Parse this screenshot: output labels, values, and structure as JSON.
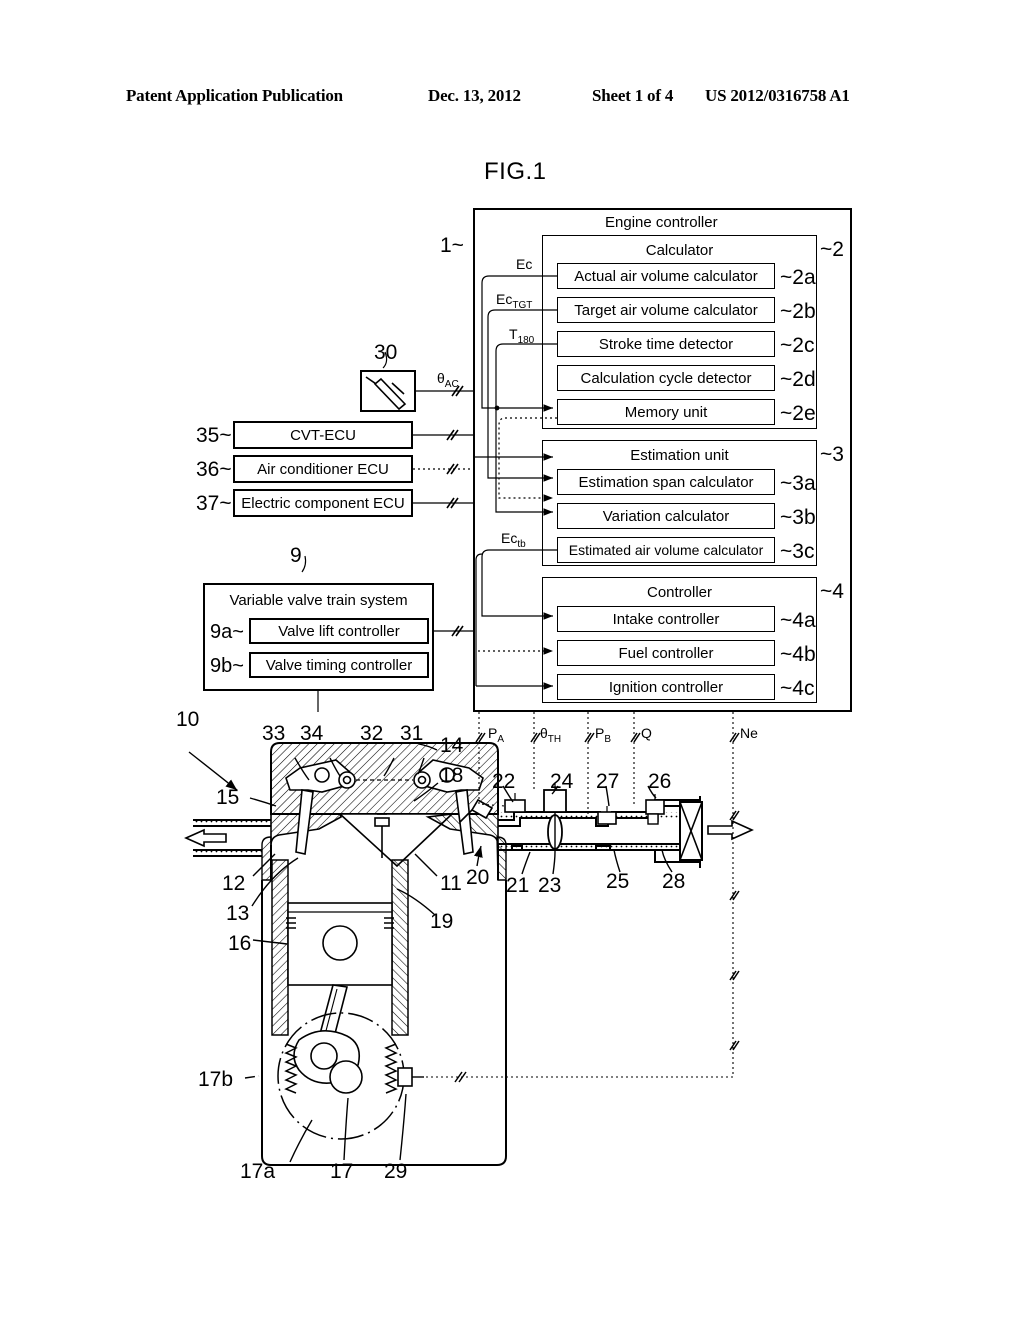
{
  "header": {
    "publication": "Patent Application Publication",
    "date": "Dec. 13, 2012",
    "sheet": "Sheet 1 of 4",
    "patent_number": "US 2012/0316758 A1"
  },
  "figure": {
    "title": "FIG.1"
  },
  "engine_controller": {
    "title": "Engine controller",
    "ref": "1",
    "ref_mark": "1~",
    "groups": [
      {
        "title": "Calculator",
        "ref": "~2",
        "items": [
          {
            "label": "Actual air volume calculator",
            "ref": "~2a"
          },
          {
            "label": "Target air volume calculator",
            "ref": "~2b"
          },
          {
            "label": "Stroke time detector",
            "ref": "~2c"
          },
          {
            "label": "Calculation cycle detector",
            "ref": "~2d"
          },
          {
            "label": "Memory unit",
            "ref": "~2e"
          }
        ]
      },
      {
        "title": "Estimation unit",
        "ref": "~3",
        "items": [
          {
            "label": "Estimation span calculator",
            "ref": "~3a"
          },
          {
            "label": "Variation calculator",
            "ref": "~3b"
          },
          {
            "label": "Estimated air volume calculator",
            "ref": "~3c"
          }
        ]
      },
      {
        "title": "Controller",
        "ref": "~4",
        "items": [
          {
            "label": "Intake controller",
            "ref": "~4a"
          },
          {
            "label": "Fuel controller",
            "ref": "~4b"
          },
          {
            "label": "Ignition controller",
            "ref": "~4c"
          }
        ]
      }
    ]
  },
  "external_units": [
    {
      "label": "CVT-ECU",
      "ref": "35~"
    },
    {
      "label": "Air conditioner ECU",
      "ref": "36~"
    },
    {
      "label": "Electric component ECU",
      "ref": "37~"
    }
  ],
  "accel_sensor": {
    "ref": "30",
    "signal": "θAC"
  },
  "valve_train": {
    "title": "Variable valve train system",
    "ref": "9",
    "items": [
      {
        "label": "Valve lift controller",
        "ref": "9a~"
      },
      {
        "label": "Valve timing controller",
        "ref": "9b~"
      }
    ]
  },
  "internal_signals": [
    {
      "name": "Ec"
    },
    {
      "name": "EcTGT",
      "base": "Ec",
      "sub": "TGT"
    },
    {
      "name": "T180",
      "base": "T",
      "sub": "180"
    },
    {
      "name": "Ectb",
      "base": "Ec",
      "sub": "tb"
    }
  ],
  "sensor_signals": [
    {
      "name": "PA",
      "base": "P",
      "sub": "A"
    },
    {
      "name": "θTH",
      "base": "θ",
      "sub": "TH"
    },
    {
      "name": "PB",
      "base": "P",
      "sub": "B"
    },
    {
      "name": "Q",
      "base": "Q",
      "sub": ""
    },
    {
      "name": "Ne",
      "base": "Ne",
      "sub": ""
    }
  ],
  "engine_callouts": [
    {
      "ref": "10"
    },
    {
      "ref": "33"
    },
    {
      "ref": "34"
    },
    {
      "ref": "32"
    },
    {
      "ref": "31"
    },
    {
      "ref": "14"
    },
    {
      "ref": "18"
    },
    {
      "ref": "15"
    },
    {
      "ref": "12"
    },
    {
      "ref": "11"
    },
    {
      "ref": "13"
    },
    {
      "ref": "19"
    },
    {
      "ref": "16"
    },
    {
      "ref": "22"
    },
    {
      "ref": "24"
    },
    {
      "ref": "27"
    },
    {
      "ref": "26"
    },
    {
      "ref": "21"
    },
    {
      "ref": "23"
    },
    {
      "ref": "25"
    },
    {
      "ref": "28"
    },
    {
      "ref": "20"
    },
    {
      "ref": "17b"
    },
    {
      "ref": "17a"
    },
    {
      "ref": "17"
    },
    {
      "ref": "29"
    }
  ],
  "colors": {
    "line": "#000000",
    "background": "#ffffff"
  }
}
